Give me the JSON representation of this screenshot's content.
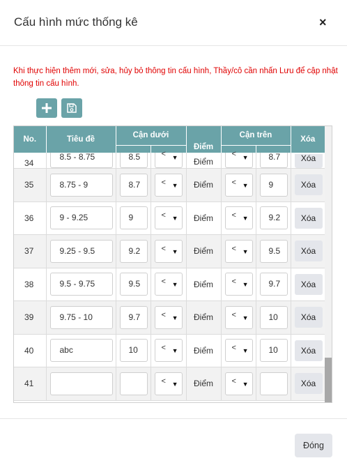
{
  "modal": {
    "title": "Cấu hình mức thống kê",
    "close_icon": "×",
    "notice": "Khi thực hiện thêm mới, sửa, hủy bỏ thông tin cấu hình, Thầy/cô cần nhấn Lưu để cập nhật thông tin cấu hình."
  },
  "toolbar": {
    "add_icon": "plus-icon",
    "save_icon": "floppy-disk-icon"
  },
  "table": {
    "headers": {
      "no": "No.",
      "title": "Tiêu đề",
      "lower": "Cận dưới",
      "score": "Điểm",
      "upper": "Cận trên",
      "delete": "Xóa"
    },
    "rows": [
      {
        "no": "34",
        "title": "8.5 - 8.75",
        "lower": "8.5",
        "lower_op": "<",
        "unit": "Điểm",
        "upper_op": "<",
        "upper": "8.7",
        "delete": "Xóa"
      },
      {
        "no": "35",
        "title": "8.75 - 9",
        "lower": "8.7",
        "lower_op": "<",
        "unit": "Điểm",
        "upper_op": "<",
        "upper": "9",
        "delete": "Xóa"
      },
      {
        "no": "36",
        "title": "9 - 9.25",
        "lower": "9",
        "lower_op": "<",
        "unit": "Điểm",
        "upper_op": "<",
        "upper": "9.2",
        "delete": "Xóa"
      },
      {
        "no": "37",
        "title": "9.25 - 9.5",
        "lower": "9.2",
        "lower_op": "<",
        "unit": "Điểm",
        "upper_op": "<",
        "upper": "9.5",
        "delete": "Xóa"
      },
      {
        "no": "38",
        "title": "9.5 - 9.75",
        "lower": "9.5",
        "lower_op": "<",
        "unit": "Điểm",
        "upper_op": "<",
        "upper": "9.7",
        "delete": "Xóa"
      },
      {
        "no": "39",
        "title": "9.75 - 10",
        "lower": "9.7",
        "lower_op": "<",
        "unit": "Điểm",
        "upper_op": "<",
        "upper": "10",
        "delete": "Xóa"
      },
      {
        "no": "40",
        "title": "abc",
        "lower": "10",
        "lower_op": "<",
        "unit": "Điểm",
        "upper_op": "<",
        "upper": "10",
        "delete": "Xóa"
      },
      {
        "no": "41",
        "title": "",
        "lower": "",
        "lower_op": "<",
        "unit": "Điểm",
        "upper_op": "<",
        "upper": "",
        "delete": "Xóa"
      }
    ]
  },
  "footer": {
    "close_label": "Đóng"
  },
  "colors": {
    "header_bg": "#6aa3a8",
    "notice": "#e00000",
    "delete_bg": "#e4e6eb"
  }
}
